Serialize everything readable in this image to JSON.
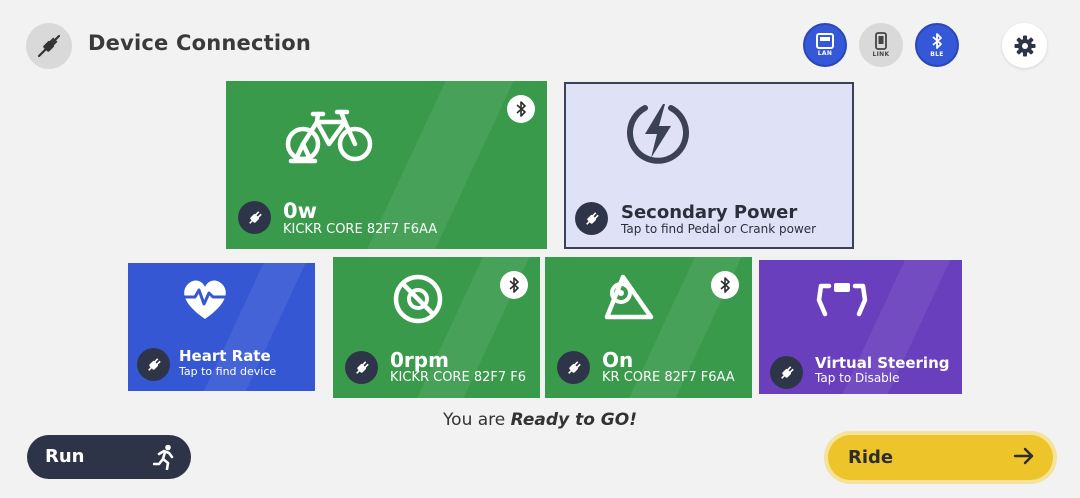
{
  "header": {
    "title": "Device Connection",
    "icon": "plug-off-icon"
  },
  "connection_modes": [
    {
      "label": "LAN",
      "active": true
    },
    {
      "label": "LINK",
      "active": false
    },
    {
      "label": "BLE",
      "active": true
    }
  ],
  "tiles": {
    "power": {
      "value": "0w",
      "device": "KICKR CORE 82F7 F6AA"
    },
    "secondary_power": {
      "title": "Secondary Power",
      "subtitle": "Tap to find Pedal or Crank power"
    },
    "heart_rate": {
      "title": "Heart Rate",
      "subtitle": "Tap to find device"
    },
    "cadence": {
      "value": "0rpm",
      "device": "KICKR CORE 82F7 F6"
    },
    "trainer": {
      "value": "On",
      "device": "KR CORE 82F7 F6AA"
    },
    "steering": {
      "title": "Virtual Steering",
      "subtitle": "Tap to Disable"
    }
  },
  "status": {
    "prefix": "You are",
    "emphasis": "Ready to GO!"
  },
  "buttons": {
    "run": "Run",
    "ride": "Ride"
  },
  "colors": {
    "green": "#3a9a4b",
    "blue": "#3557d4",
    "purple": "#6a3fbd",
    "ride": "#edc52a",
    "dark": "#2e3447"
  }
}
